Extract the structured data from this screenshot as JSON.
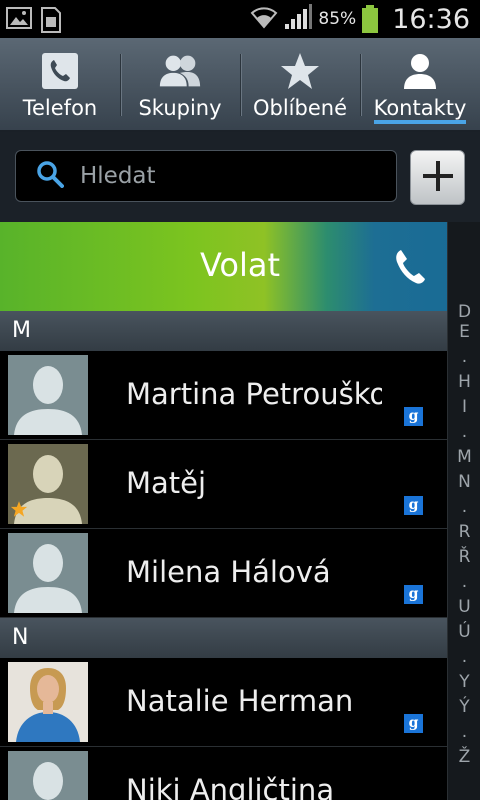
{
  "status_bar": {
    "battery_percent": "85%",
    "time": "16:36",
    "icons": [
      "picture-icon",
      "sim-card-icon",
      "wifi-icon",
      "signal-icon",
      "battery-icon"
    ]
  },
  "tabs": [
    {
      "label": "Telefon",
      "icon": "phone-icon",
      "active": false
    },
    {
      "label": "Skupiny",
      "icon": "groups-icon",
      "active": false
    },
    {
      "label": "Oblíbené",
      "icon": "star-icon",
      "active": false
    },
    {
      "label": "Kontakty",
      "icon": "contact-icon",
      "active": true
    }
  ],
  "search": {
    "placeholder": "Hledat",
    "value": ""
  },
  "call_bar": {
    "label": "Volat"
  },
  "contacts": {
    "sections": [
      {
        "letter": "M",
        "rows": [
          {
            "name": "Martina Petrouško",
            "avatar": "placeholder",
            "favorite": false,
            "account_badge": "g"
          },
          {
            "name": "Matěj",
            "avatar": "placeholder-olive",
            "favorite": true,
            "account_badge": "g"
          },
          {
            "name": "Milena Hálová",
            "avatar": "placeholder",
            "favorite": false,
            "account_badge": "g"
          }
        ]
      },
      {
        "letter": "N",
        "rows": [
          {
            "name": "Natalie Herman",
            "avatar": "photo",
            "favorite": false,
            "account_badge": "g"
          },
          {
            "name": "Niki Angličtina",
            "avatar": "placeholder",
            "favorite": false,
            "account_badge": ""
          }
        ]
      }
    ]
  },
  "index_letters": [
    "D",
    "E",
    ".",
    "H",
    "I",
    ".",
    "M",
    "N",
    ".",
    "R",
    "Ř",
    ".",
    "U",
    "Ú",
    ".",
    "Y",
    "Ý",
    ".",
    "Ž"
  ],
  "colors": {
    "accent": "#4aa4e6",
    "call_green": "#7cc41f",
    "call_blue": "#186a96",
    "google_badge": "#1a74d8"
  }
}
